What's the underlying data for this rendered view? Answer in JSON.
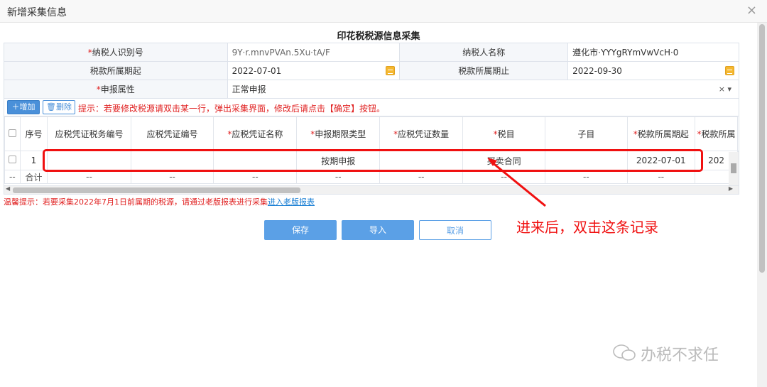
{
  "window": {
    "title": "新增采集信息",
    "close_glyph": "×"
  },
  "form_title": "印花税税源信息采集",
  "info": {
    "taxpayer_id_label": "纳税人识别号",
    "taxpayer_id_value": "9Y·r.mnvPVAn.5Xu·tA/F",
    "taxpayer_name_label": "纳税人名称",
    "taxpayer_name_value": "遵化市·YYYgRYmVwVcH·0",
    "period_start_label": "税款所属期起",
    "period_start_value": "2022-07-01",
    "period_end_label": "税款所属期止",
    "period_end_value": "2022-09-30",
    "declare_attr_label": "申报属性",
    "declare_attr_value": "正常申报",
    "select_icons": "× ▾"
  },
  "toolbar": {
    "add_label": "增加",
    "delete_label": "删除",
    "tip": "提示：若要修改税源请双击某一行，弹出采集界面，修改后请点击【确定】按钮。"
  },
  "grid": {
    "columns": [
      {
        "label": "序号",
        "required": false
      },
      {
        "label": "应税凭证税务编号",
        "required": false
      },
      {
        "label": "应税凭证编号",
        "required": false
      },
      {
        "label": "应税凭证名称",
        "required": true
      },
      {
        "label": "申报期限类型",
        "required": true
      },
      {
        "label": "应税凭证数量",
        "required": true
      },
      {
        "label": "税目",
        "required": true
      },
      {
        "label": "子目",
        "required": false
      },
      {
        "label": "税款所属期起",
        "required": true
      },
      {
        "label": "税款所属",
        "required": true
      }
    ],
    "row": [
      "1",
      "",
      "",
      "",
      "按期申报",
      "",
      "买卖合同",
      "",
      "2022-07-01",
      "202"
    ],
    "sum_row": [
      "--",
      "合计",
      "--",
      "--",
      "--",
      "--",
      "--",
      "--",
      "--",
      "--"
    ]
  },
  "warm_tip": {
    "text": "温馨提示：若要采集2022年7月1日前属期的税源，请通过老版报表进行采集",
    "link": "进入老版报表"
  },
  "buttons": {
    "save": "保存",
    "import": "导入",
    "cancel": "取消"
  },
  "annotation": "进来后，双击这条记录",
  "watermark": "办税不求任",
  "colors": {
    "accent": "#5ba0e6",
    "warning": "#e02020",
    "highlight": "#f01010"
  }
}
